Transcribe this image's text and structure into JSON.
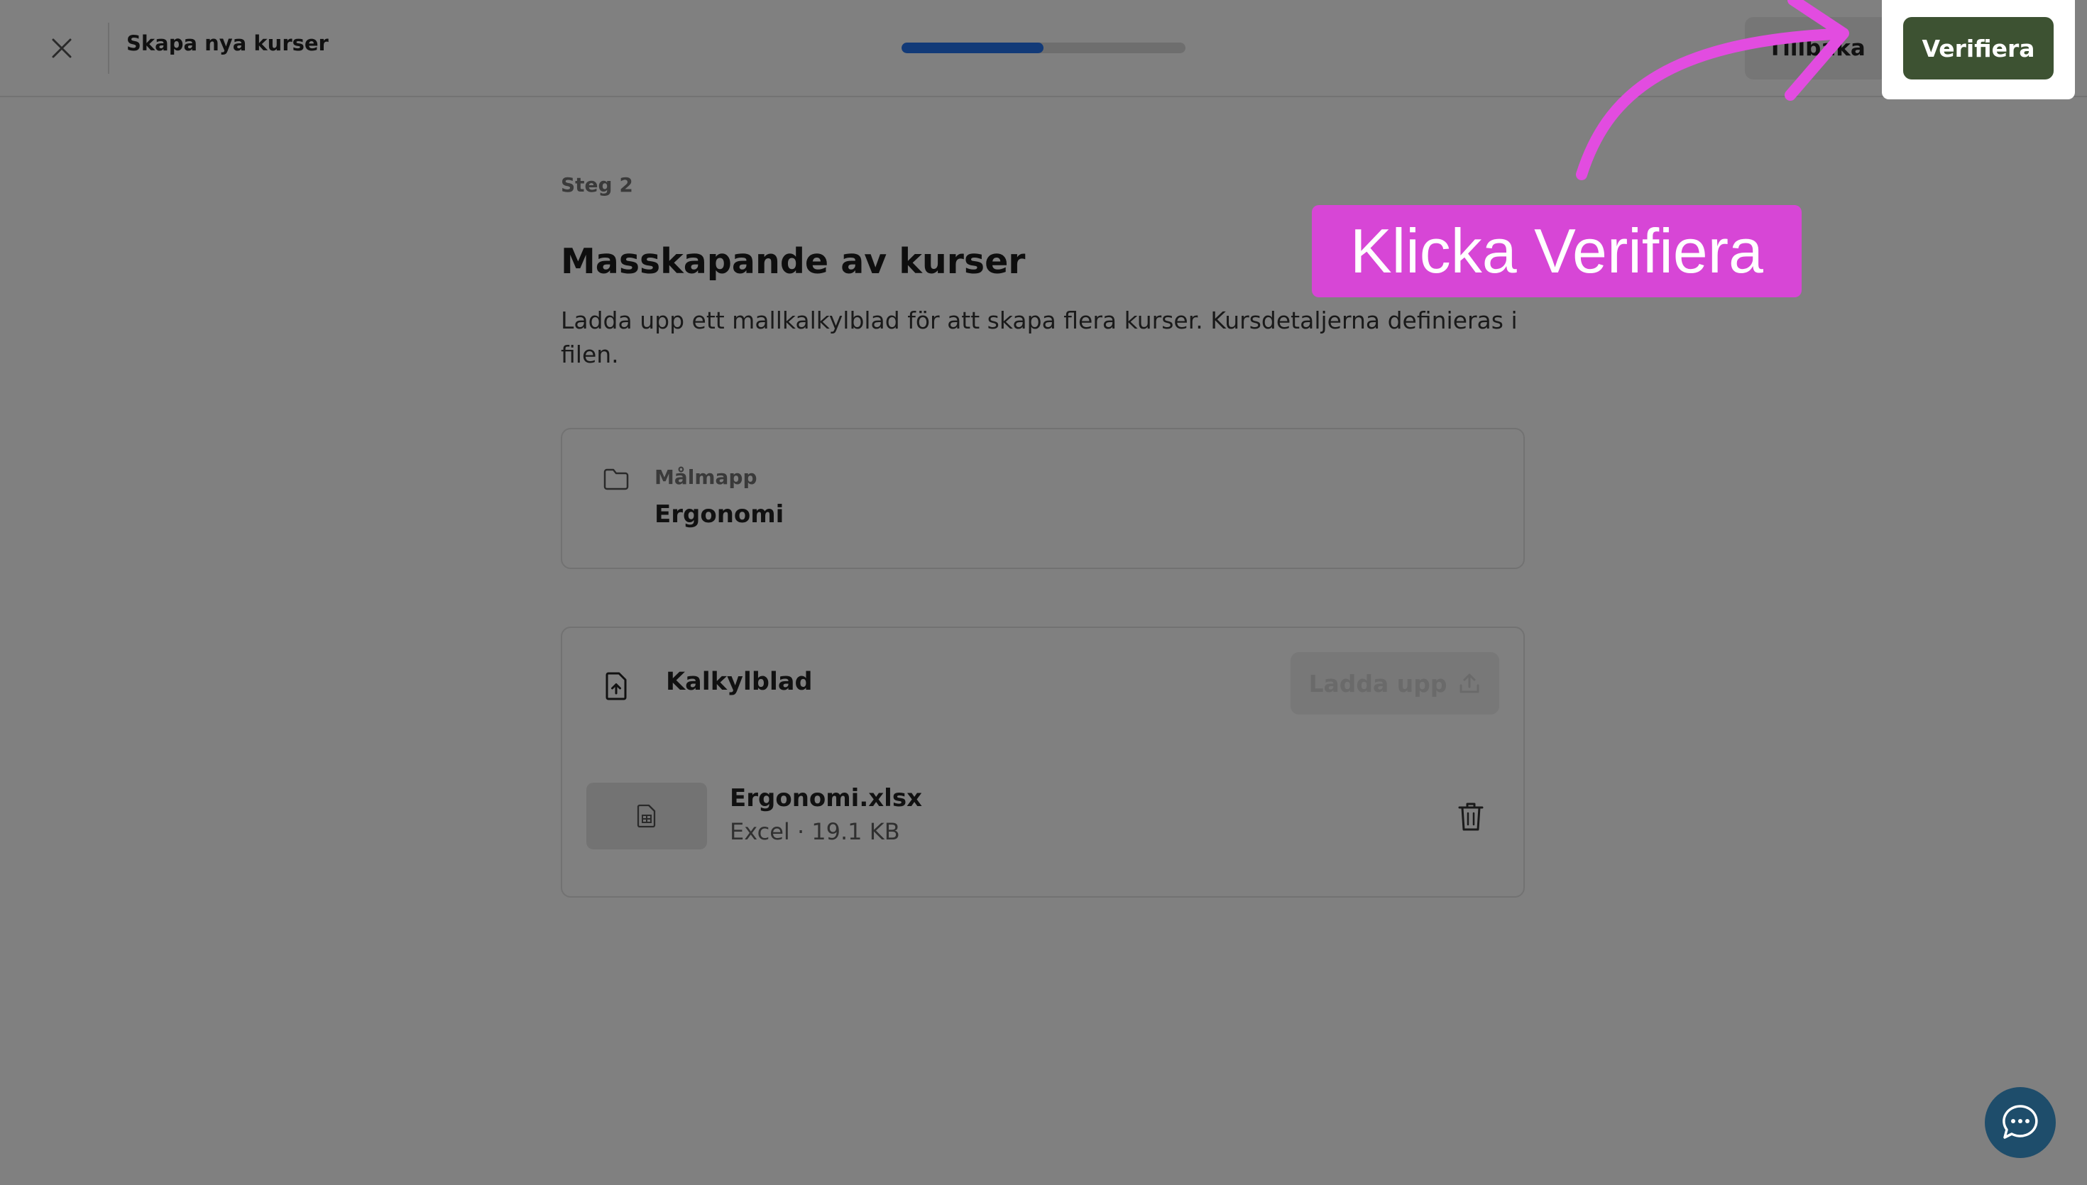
{
  "header": {
    "title": "Skapa nya kurser",
    "progress_fraction": 0.5,
    "back_label": "Tillbaka",
    "verify_label": "Verifiera"
  },
  "main": {
    "step": "Steg 2",
    "title": "Masskapande av kurser",
    "description": "Ladda upp ett mallkalkylblad för att skapa flera kurser. Kursdetaljerna definieras i filen."
  },
  "folder_card": {
    "label": "Målmapp",
    "value": "Ergonomi",
    "icon": "folder-icon"
  },
  "sheet_card": {
    "title": "Kalkylblad",
    "icon": "file-upload-icon",
    "upload_label": "Ladda upp",
    "file": {
      "name": "Ergonomi.xlsx",
      "meta": "Excel · 19.1 KB",
      "icon": "spreadsheet-icon"
    }
  },
  "annotation": {
    "text": "Klicka Verifiera",
    "color": "#d746d6"
  },
  "colors": {
    "accent_green": "#3d5232",
    "progress_blue": "#123a78"
  }
}
